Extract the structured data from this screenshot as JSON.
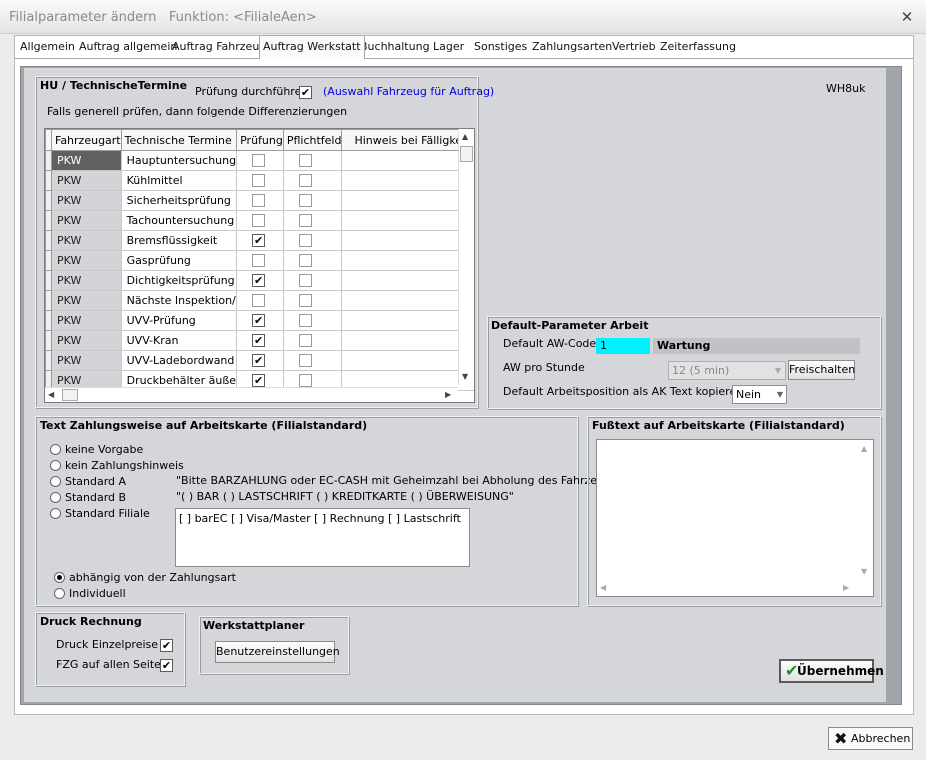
{
  "window": {
    "title": "Filialparameter ändern   Funktion: <FilialeAen>",
    "close_glyph": "✕"
  },
  "tabs": [
    "Allgemein",
    "Auftrag allgemein",
    "Auftrag Fahrzeug",
    "Auftrag Werkstatt",
    "Buchhaltung",
    "Lager",
    "Sonstiges",
    "Zahlungsarten",
    "Vertrieb",
    "Zeiterfassung"
  ],
  "active_tab": "Auftrag Werkstatt",
  "user_code": "WH8uk",
  "hu": {
    "title": "HU / TechnischeTermine",
    "pruefung_label": "Prüfung durchführen",
    "pruefung_checked": true,
    "hint": "(Auswahl Fahrzeug für Auftrag)",
    "subtitle": "Falls generell prüfen, dann folgende Differenzierungen",
    "columns": [
      "Fahrzeugart",
      "Technische Termine",
      "Prüfung",
      "Pflichtfeld",
      "Hinweis bei Fälligkeit in"
    ],
    "rows": [
      {
        "art": "PKW",
        "termin": "Hauptuntersuchung",
        "pruefung": false,
        "pflicht": false,
        "hinweis": ""
      },
      {
        "art": "PKW",
        "termin": "Kühlmittel",
        "pruefung": false,
        "pflicht": false,
        "hinweis": ""
      },
      {
        "art": "PKW",
        "termin": "Sicherheitsprüfung",
        "pruefung": false,
        "pflicht": false,
        "hinweis": ""
      },
      {
        "art": "PKW",
        "termin": "Tachountersuchung",
        "pruefung": false,
        "pflicht": false,
        "hinweis": ""
      },
      {
        "art": "PKW",
        "termin": "Bremsflüssigkeit",
        "pruefung": true,
        "pflicht": false,
        "hinweis": ""
      },
      {
        "art": "PKW",
        "termin": "Gasprüfung",
        "pruefung": false,
        "pflicht": false,
        "hinweis": ""
      },
      {
        "art": "PKW",
        "termin": "Dichtigkeitsprüfung",
        "pruefung": true,
        "pflicht": false,
        "hinweis": ""
      },
      {
        "art": "PKW",
        "termin": "Nächste Inspektion/",
        "pruefung": false,
        "pflicht": false,
        "hinweis": ""
      },
      {
        "art": "PKW",
        "termin": "UVV-Prüfung",
        "pruefung": true,
        "pflicht": false,
        "hinweis": ""
      },
      {
        "art": "PKW",
        "termin": "UVV-Kran",
        "pruefung": true,
        "pflicht": false,
        "hinweis": ""
      },
      {
        "art": "PKW",
        "termin": "UVV-Ladebordwand",
        "pruefung": true,
        "pflicht": false,
        "hinweis": ""
      },
      {
        "art": "PKW",
        "termin": "Druckbehälter äuße",
        "pruefung": true,
        "pflicht": false,
        "hinweis": ""
      }
    ]
  },
  "default_arbeit": {
    "title": "Default-Parameter Arbeit",
    "aw_code_label": "Default AW-Code",
    "aw_code_value": "1",
    "aw_code_desc": "Wartung",
    "aw_stunde_label": "AW pro Stunde",
    "aw_stunde_value": "12 (5 min)",
    "freischalten": "Freischalten",
    "ak_label": "Default Arbeitsposition als AK Text kopieren",
    "ak_value": "Nein"
  },
  "zahlungsweise": {
    "title": "Text Zahlungsweise auf Arbeitskarte (Filialstandard)",
    "options": [
      "keine Vorgabe",
      "kein Zahlungshinweis",
      "Standard A",
      "Standard B",
      "Standard Filiale"
    ],
    "selected_option": -1,
    "standard_a_text": "\"Bitte BARZAHLUNG oder EC-CASH mit Geheimzahl bei Abholung des Fahrzeuges\"",
    "standard_b_text": "\"( ) BAR ( ) LASTSCHRIFT ( ) KREDITKARTE ( ) ÜBERWEISUNG\"",
    "filiale_text": "[ ] barEC [ ] Visa/Master [ ] Rechnung [ ] Lastschrift",
    "mode_options": [
      "abhängig von der Zahlungsart",
      "Individuell"
    ],
    "mode_selected": 0
  },
  "fusstext": {
    "title": "Fußtext auf Arbeitskarte (Filialstandard)",
    "value": ""
  },
  "druck": {
    "title": "Druck Rechnung",
    "einzelpreise_label": "Druck Einzelpreise",
    "einzelpreise_checked": true,
    "fzg_label": "FZG auf allen Seiten",
    "fzg_checked": true
  },
  "werkstattplaner": {
    "title": "Werkstattplaner",
    "button": "Benutzereinstellungen"
  },
  "buttons": {
    "uebernehmen": "Übernehmen",
    "abbrechen": "Abbrechen"
  },
  "colors": {
    "aw_code_bg": "#00f0ff",
    "panel_bg": "#d4d6da",
    "hint_color": "#0000e0"
  }
}
